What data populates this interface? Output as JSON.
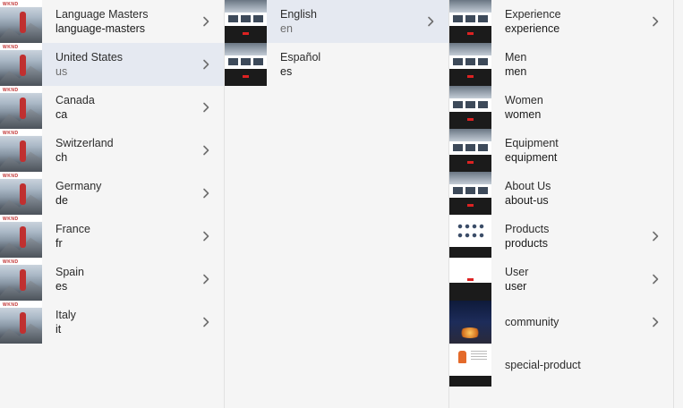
{
  "columns": [
    {
      "items": [
        {
          "title": "Language Masters",
          "subtitle": "language-masters",
          "thumb": "mountain",
          "selected": false,
          "chevron": true
        },
        {
          "title": "United States",
          "subtitle": "us",
          "thumb": "mountain",
          "selected": true,
          "chevron": true
        },
        {
          "title": "Canada",
          "subtitle": "ca",
          "thumb": "mountain",
          "selected": false,
          "chevron": true
        },
        {
          "title": "Switzerland",
          "subtitle": "ch",
          "thumb": "mountain",
          "selected": false,
          "chevron": true
        },
        {
          "title": "Germany",
          "subtitle": "de",
          "thumb": "mountain",
          "selected": false,
          "chevron": true
        },
        {
          "title": "France",
          "subtitle": "fr",
          "thumb": "mountain",
          "selected": false,
          "chevron": true
        },
        {
          "title": "Spain",
          "subtitle": "es",
          "thumb": "mountain",
          "selected": false,
          "chevron": true
        },
        {
          "title": "Italy",
          "subtitle": "it",
          "thumb": "mountain",
          "selected": false,
          "chevron": true
        }
      ]
    },
    {
      "items": [
        {
          "title": "English",
          "subtitle": "en",
          "thumb": "page",
          "selected": true,
          "chevron": true
        },
        {
          "title": "Español",
          "subtitle": "es",
          "thumb": "page",
          "selected": false,
          "chevron": false
        }
      ]
    },
    {
      "items": [
        {
          "title": "Experience",
          "subtitle": "experience",
          "thumb": "page",
          "selected": false,
          "chevron": true
        },
        {
          "title": "Men",
          "subtitle": "men",
          "thumb": "page",
          "selected": false,
          "chevron": false
        },
        {
          "title": "Women",
          "subtitle": "women",
          "thumb": "page",
          "selected": false,
          "chevron": false
        },
        {
          "title": "Equipment",
          "subtitle": "equipment",
          "thumb": "page",
          "selected": false,
          "chevron": false
        },
        {
          "title": "About Us",
          "subtitle": "about-us",
          "thumb": "page",
          "selected": false,
          "chevron": false
        },
        {
          "title": "Products",
          "subtitle": "products",
          "thumb": "products",
          "selected": false,
          "chevron": true
        },
        {
          "title": "User",
          "subtitle": "user",
          "thumb": "user",
          "selected": false,
          "chevron": true
        },
        {
          "title": "community",
          "subtitle": "",
          "thumb": "night",
          "selected": false,
          "chevron": true
        },
        {
          "title": "special-product",
          "subtitle": "",
          "thumb": "special",
          "selected": false,
          "chevron": false
        }
      ]
    }
  ],
  "logo_text": "WKND",
  "icons": {
    "chevron": "chevron-right-icon"
  },
  "colors": {
    "selected_row": "#e5e9f1",
    "background": "#f5f5f5",
    "divider": "#e1e1e1"
  }
}
